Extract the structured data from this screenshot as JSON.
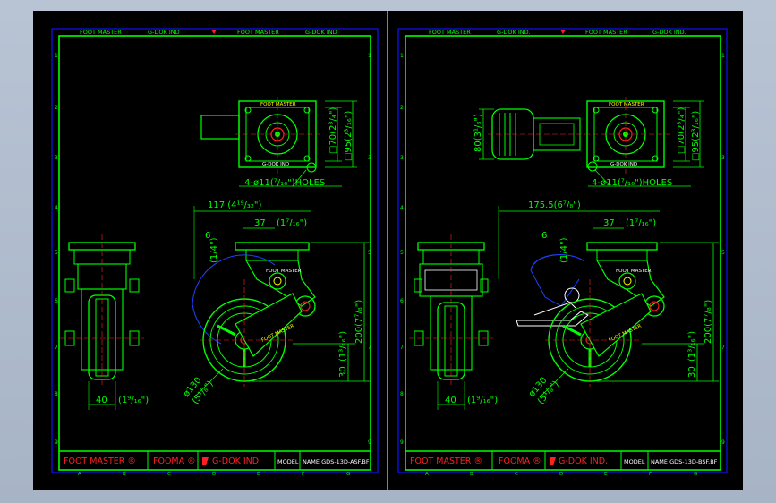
{
  "colors": {
    "background": "#000000",
    "frame": "#1010ff",
    "border": "#00ff00",
    "red": "#ff2020",
    "green": "#00ff00",
    "yellow": "#ffff00",
    "cyan": "#00ffff",
    "white": "#ffffff",
    "blue_arc": "#2040ff"
  },
  "header": {
    "left": [
      "FOOT MASTER",
      "G-DOK IND",
      "FOOT MASTER",
      "G-DOK IND"
    ],
    "right": [
      "FOOT MASTER",
      "G-DOK IND.",
      "FOOT MASTER",
      "G-DOK IND."
    ]
  },
  "row_labels": [
    "1",
    "2",
    "3",
    "4",
    "5",
    "6",
    "7",
    "8",
    "9"
  ],
  "col_labels": [
    "A",
    "B",
    "C",
    "D",
    "E",
    "F",
    "G"
  ],
  "left_sheet": {
    "dims": {
      "top_plate_h": "□70(2³/₄\")",
      "top_plate_w": "□95(2³/₁₆\")",
      "holes": "4-ø11(⁷/₁₆\")HOLES",
      "offset": "117 (4¹⁹/₃₂\")",
      "d37": "37",
      "d37_in": "(1⁷/₁₆\")",
      "d6": "6",
      "d6_in": "(1/4\")",
      "height": "200(7⁷/₈\")",
      "h30": "30",
      "h30_in": "(1³/₁₆\")",
      "dia": "ø130",
      "dia_in": "(5¹/₈\")",
      "width": "40",
      "width_in": "(1⁹/₁₆\")"
    },
    "labels": {
      "plate_top": "FOOT MASTER",
      "plate_bottom": "G-DOK IND",
      "arm": "FOOT MASTER",
      "wheel": "FOOT MASTER"
    },
    "title_block": {
      "brand1": "FOOT MASTER ®",
      "brand2": "FOOMA ®",
      "brand3": "G-DOK IND.",
      "model_label": "MODEL",
      "model_value": "NAME GDS-13D-ASF.BF"
    }
  },
  "right_sheet": {
    "dims": {
      "top_plate_h": "□70(2³/₄\")",
      "top_plate_w": "□95(2³/₁₆\")",
      "holes": "4-ø11(⁷/₁₆\")HOLES",
      "pedal": "80(3¹/₈\")",
      "offset": "175.5(6⁷/₈\")",
      "d37": "37",
      "d37_in": "(1⁷/₁₆\")",
      "d6": "6",
      "d6_in": "(1/4\")",
      "height": "200(7⁷/₈\")",
      "h30": "30",
      "h30_in": "(1³/₁₆\")",
      "dia": "ø130",
      "dia_in": "(5¹/₈\")",
      "width": "40",
      "width_in": "(1⁹/₁₆\")"
    },
    "labels": {
      "plate_top": "FOOT MASTER",
      "plate_bottom": "G-DOK IND",
      "arm": "FOOT MASTER",
      "wheel": "FOOT MASTER"
    },
    "title_block": {
      "brand1": "FOOT MASTER ®",
      "brand2": "FOOMA ®",
      "brand3": "G-DOK IND.",
      "model_label": "MODEL",
      "model_value": "NAME GDS-13D-BSF.BF"
    }
  }
}
